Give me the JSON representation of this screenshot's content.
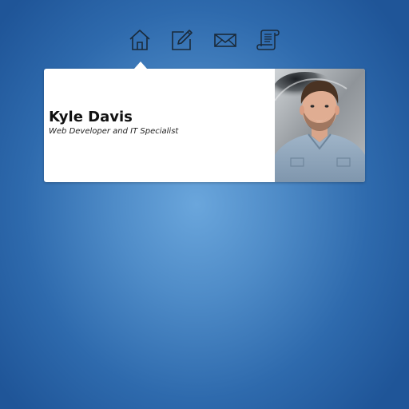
{
  "nav": {
    "items": [
      {
        "icon": "home-icon"
      },
      {
        "icon": "edit-icon"
      },
      {
        "icon": "envelope-icon"
      },
      {
        "icon": "scroll-icon"
      }
    ],
    "icon_color": "#1a2a3a"
  },
  "profile": {
    "name": "Kyle Davis",
    "subtitle": "Web Developer and IT Specialist"
  },
  "colors": {
    "background": "#4f8cc8",
    "card": "#ffffff"
  }
}
